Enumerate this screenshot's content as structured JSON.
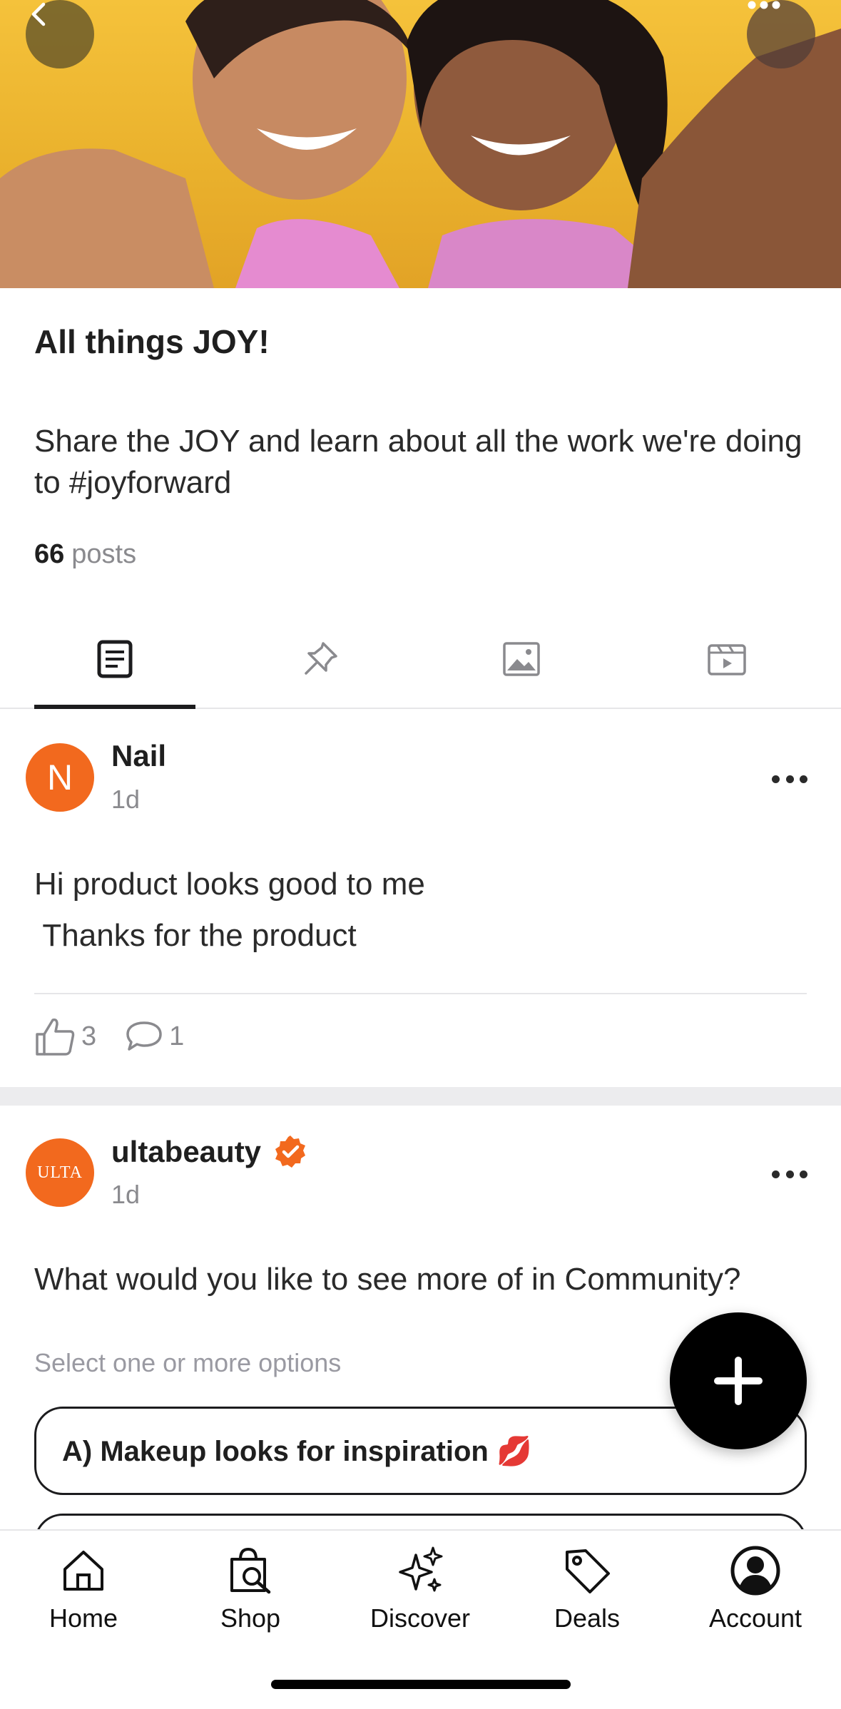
{
  "hero": {
    "back_icon": "chevron-left-icon",
    "more_icon": "more-horizontal-icon"
  },
  "group": {
    "title": "All things JOY!",
    "description": "Share the JOY and learn about all the work we're doing to #joyforward",
    "posts_count": "66",
    "posts_label": "posts"
  },
  "tabs": [
    {
      "name": "posts",
      "icon": "document-icon",
      "active": true
    },
    {
      "name": "pinned",
      "icon": "pin-icon",
      "active": false
    },
    {
      "name": "photos",
      "icon": "image-icon",
      "active": false
    },
    {
      "name": "videos",
      "icon": "video-icon",
      "active": false
    }
  ],
  "posts": [
    {
      "avatar_letter": "N",
      "author": "Nail",
      "time": "1d",
      "body": "Hi product looks good to me\n Thanks for the product",
      "likes": "3",
      "comments": "1"
    },
    {
      "avatar_text": "ULTA",
      "author": "ultabeauty",
      "verified": true,
      "time": "1d",
      "question": "What would you like to see more of in Community?",
      "hint": "Select one or more options",
      "options": [
        "A) Makeup looks for inspiration 💋"
      ]
    }
  ],
  "nav": [
    {
      "label": "Home",
      "icon": "home-icon"
    },
    {
      "label": "Shop",
      "icon": "shopping-bag-search-icon"
    },
    {
      "label": "Discover",
      "icon": "sparkles-icon"
    },
    {
      "label": "Deals",
      "icon": "tag-icon"
    },
    {
      "label": "Account",
      "icon": "user-circle-icon"
    }
  ],
  "colors": {
    "accent_orange": "#f2691e",
    "hero_yellow": "#f5c23b",
    "text_primary": "#1f1f1f",
    "text_secondary": "#8a8a8e"
  }
}
